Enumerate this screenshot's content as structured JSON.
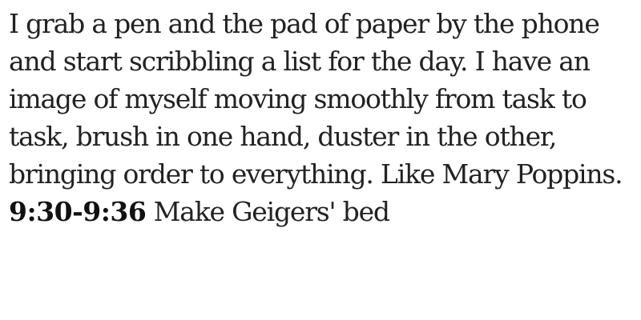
{
  "passage": {
    "text": "I grab a pen and the pad of paper by the phone and start scribbling a list for the day. I have an image of myself moving smoothly from task to task, brush in one hand, duster in the other, bringing order to everything. Like Mary Poppins.",
    "time_range": "9:30-9:36",
    "task": "Make Geigers' bed"
  },
  "colors": {
    "text": "#222222",
    "background": "#ffffff"
  }
}
